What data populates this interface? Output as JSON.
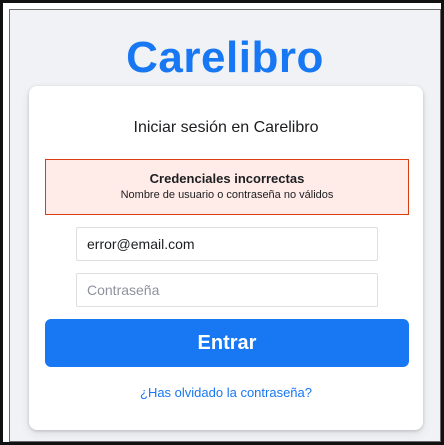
{
  "app": {
    "logo": "Carelibro",
    "brand_color": "#1877f2"
  },
  "login": {
    "title": "Iniciar sesión en Carelibro",
    "error": {
      "title": "Credenciales incorrectas",
      "message": "Nombre de usuario o contraseña no válidos",
      "background_color": "#ffebe8",
      "border_color": "#dd3c10"
    },
    "email": {
      "value": "error@email.com",
      "placeholder": ""
    },
    "password": {
      "value": "",
      "placeholder": "Contraseña"
    },
    "submit_label": "Entrar",
    "forgot_password": "¿Has olvidado la contraseña?"
  }
}
